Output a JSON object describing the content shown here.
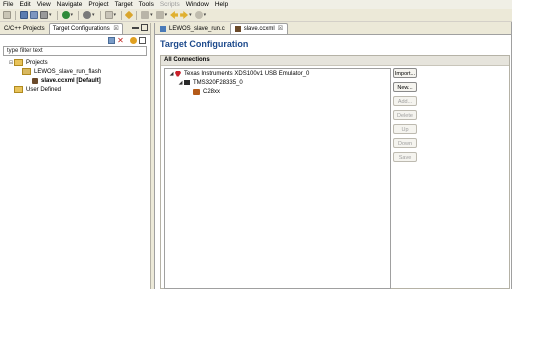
{
  "menubar": {
    "items": [
      {
        "label": "File",
        "enabled": true
      },
      {
        "label": "Edit",
        "enabled": true
      },
      {
        "label": "View",
        "enabled": true
      },
      {
        "label": "Navigate",
        "enabled": true
      },
      {
        "label": "Project",
        "enabled": true
      },
      {
        "label": "Target",
        "enabled": true
      },
      {
        "label": "Tools",
        "enabled": true
      },
      {
        "label": "Scripts",
        "enabled": false
      },
      {
        "label": "Window",
        "enabled": true
      },
      {
        "label": "Help",
        "enabled": true
      }
    ]
  },
  "left_panel": {
    "tabs": [
      {
        "label": "C/C++ Projects"
      },
      {
        "label": "Target Configurations",
        "close": "☒"
      }
    ],
    "filter_placeholder": "type filter text",
    "tree": {
      "projects_label": "Projects",
      "project_name": "LEWOS_slave_run_flash",
      "file_name": "slave.ccxml [Default]",
      "user_defined_label": "User Defined"
    }
  },
  "editor": {
    "tabs": [
      {
        "label": "LEWOS_slave_run.c"
      },
      {
        "label": "slave.ccxml",
        "close": "☒"
      }
    ],
    "title": "Target Configuration",
    "section_title": "All Connections",
    "connections": {
      "emulator": "Texas Instruments XDS100v1 USB Emulator_0",
      "device": "TMS320F28335_0",
      "core": "C28xx"
    },
    "buttons": {
      "import": "Import...",
      "new": "New...",
      "add": "Add...",
      "delete": "Delete",
      "up": "Up",
      "down": "Down",
      "save": "Save"
    }
  },
  "colors": {
    "title_blue": "#1d4a8c",
    "chrome_bg": "#ece9d8"
  }
}
